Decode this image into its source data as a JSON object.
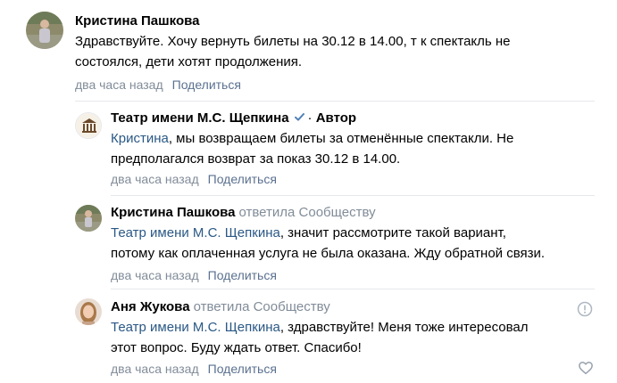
{
  "comments": [
    {
      "author": "Кристина Пашкова",
      "text": "Здравствуйте. Хочу вернуть билеты на 30.12 в 14.00, т к спектакль не\nсостоялся, дети хотят продолжения.",
      "time": "два часа назад",
      "share": "Поделиться"
    },
    {
      "author": "Театр имени М.С. Щепкина",
      "role": "Автор",
      "mention": "Кристина",
      "text": ", мы возвращаем билеты за отменённые спектакли. Не\nпредполагался возврат за показ 30.12 в 14.00.",
      "time": "два часа назад",
      "share": "Поделиться"
    },
    {
      "author": "Кристина Пашкова",
      "reply_to": "ответила Сообществу",
      "mention": "Театр имени М.С. Щепкина",
      "text": ", значит рассмотрите такой вариант,\nпотому как оплаченная услуга не была оказана. Жду обратной связи.",
      "time": "два часа назад",
      "share": "Поделиться"
    },
    {
      "author": "Аня Жукова",
      "reply_to": "ответила Сообществу",
      "mention": "Театр имени М.С. Щепкина",
      "text": ", здравствуйте! Меня тоже интересовал\nэтот вопрос. Буду ждать ответ. Спасибо!",
      "time": "два часа назад",
      "share": "Поделиться"
    }
  ],
  "icons": {
    "verified": "verified-check-icon",
    "report": "report-icon",
    "like": "heart-icon"
  },
  "colors": {
    "link": "#2a5885",
    "meta": "#818c99",
    "share": "#5b7190",
    "verified": "#5181b8"
  }
}
